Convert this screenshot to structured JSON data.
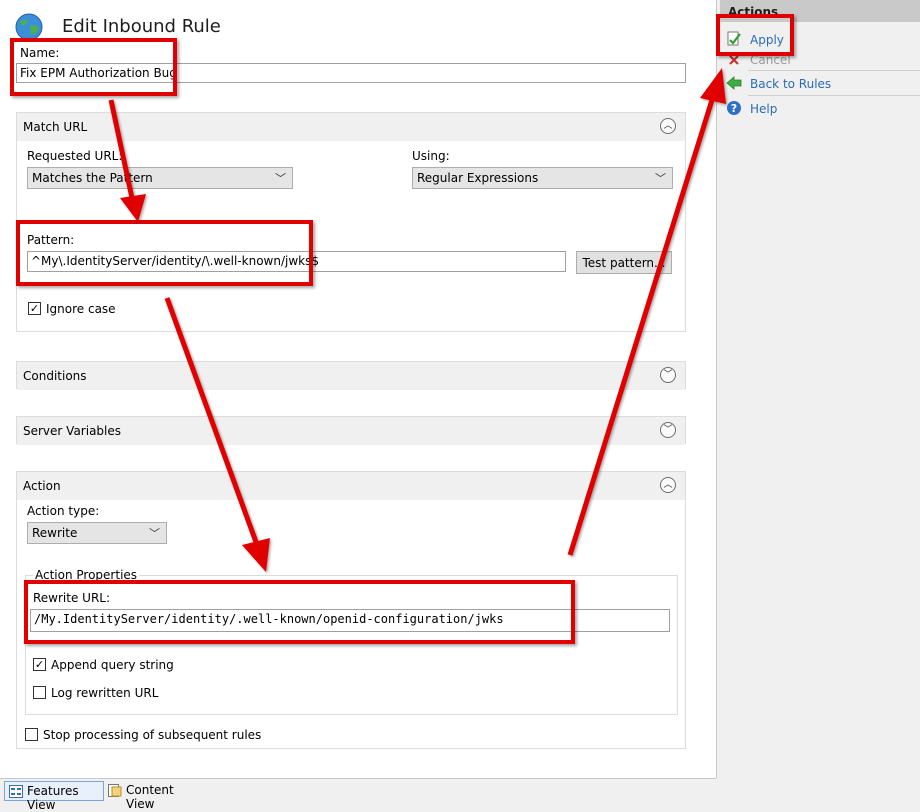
{
  "header": {
    "title": "Edit Inbound Rule"
  },
  "name_field": {
    "label": "Name:",
    "value": "Fix EPM Authorization Bug"
  },
  "match_url": {
    "title": "Match URL",
    "requested_url_label": "Requested URL:",
    "requested_url_value": "Matches the Pattern",
    "using_label": "Using:",
    "using_value": "Regular Expressions",
    "pattern_label": "Pattern:",
    "pattern_value": "^My\\.IdentityServer/identity/\\.well-known/jwks$",
    "test_button": "Test pattern...",
    "ignore_case_label": "Ignore case",
    "ignore_case_checked": true
  },
  "conditions": {
    "title": "Conditions"
  },
  "server_variables": {
    "title": "Server Variables"
  },
  "action": {
    "title": "Action",
    "action_type_label": "Action type:",
    "action_type_value": "Rewrite",
    "properties_title": "Action Properties",
    "rewrite_url_label": "Rewrite URL:",
    "rewrite_url_value": "/My.IdentityServer/identity/.well-known/openid-configuration/jwks",
    "append_query_label": "Append query string",
    "append_query_checked": true,
    "log_rewritten_label": "Log rewritten URL",
    "log_rewritten_checked": false,
    "stop_processing_label": "Stop processing of subsequent rules",
    "stop_processing_checked": false
  },
  "actions_pane": {
    "title": "Actions",
    "items": [
      {
        "label": "Apply",
        "icon": "apply-icon",
        "enabled": true
      },
      {
        "label": "Cancel",
        "icon": "cancel-icon",
        "enabled": false
      },
      {
        "label": "Back to Rules",
        "icon": "back-arrow-icon",
        "enabled": true
      },
      {
        "label": "Help",
        "icon": "help-icon",
        "enabled": true
      }
    ]
  },
  "bottom_tabs": [
    {
      "label": "Features View",
      "icon": "features-view-icon",
      "active": true
    },
    {
      "label": "Content View",
      "icon": "content-view-icon",
      "active": false
    }
  ],
  "colors": {
    "annotation": "#e00000",
    "link": "#2a6cb6",
    "pane_header": "#c9c9c9"
  }
}
